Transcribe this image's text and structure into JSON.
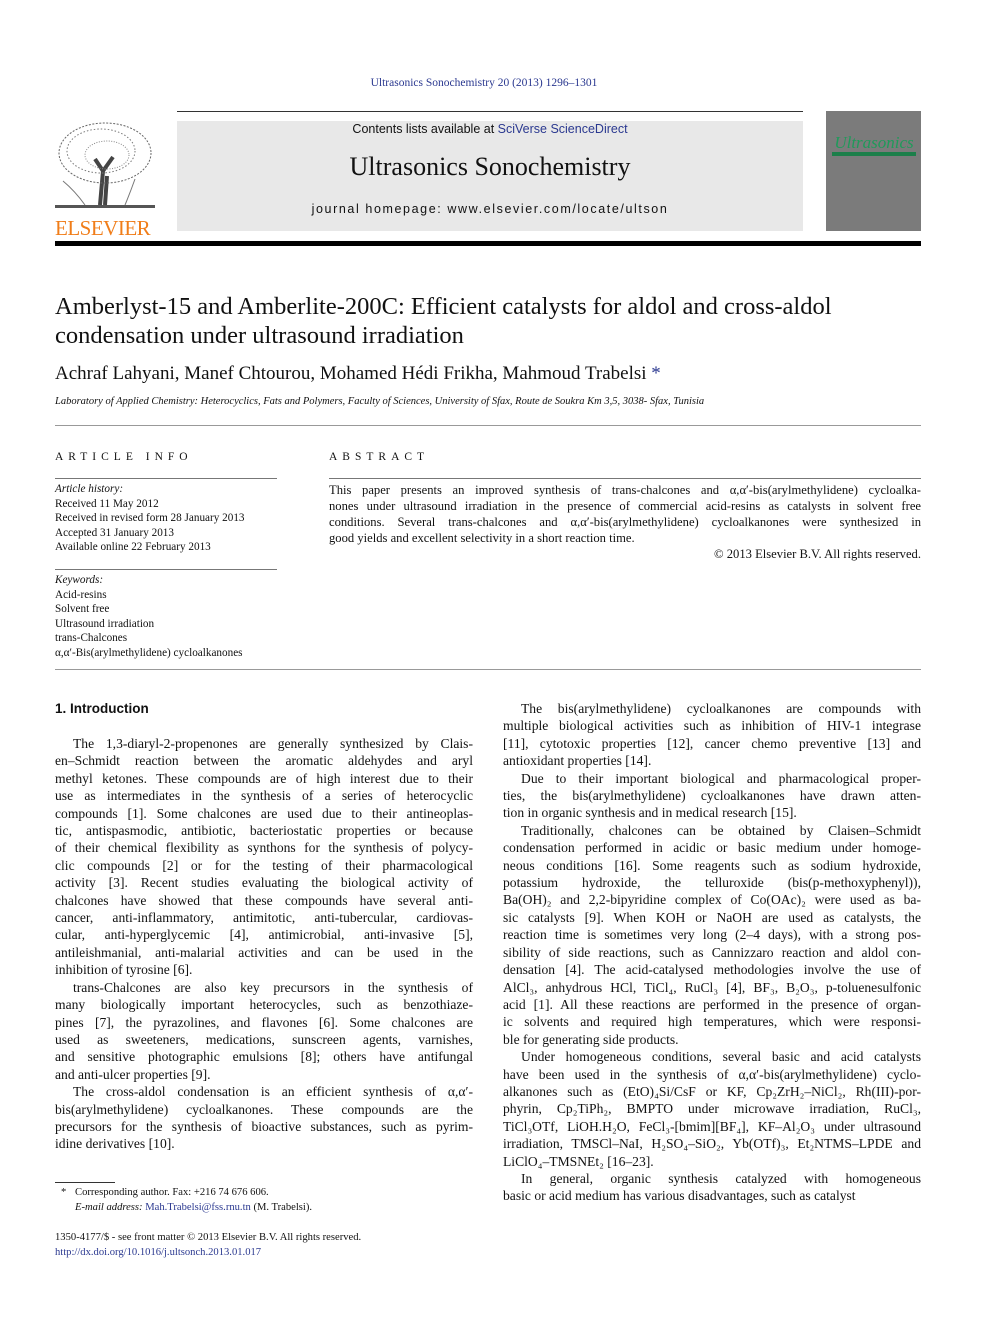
{
  "header": {
    "citation": "Ultrasonics Sonochemistry 20 (2013) 1296–1301",
    "contents_prefix": "Contents lists available at ",
    "contents_link": "SciVerse ScienceDirect",
    "journal_title": "Ultrasonics Sonochemistry",
    "homepage": "journal homepage: www.elsevier.com/locate/ultson",
    "publisher_logo": "ELSEVIER",
    "cover_title": "Ultrasonics",
    "colors": {
      "publisher_orange": "#f07d19",
      "link_blue": "#2b3990",
      "cover_green": "#1f9a5a"
    }
  },
  "article": {
    "title_line1": "Amberlyst-15 and Amberlite-200C: Efficient catalysts for aldol and cross-aldol",
    "title_line2": "condensation under ultrasound irradiation",
    "authors": "Achraf Lahyani, Manef Chtourou, Mohamed Hédi Frikha, Mahmoud Trabelsi",
    "author_mark": "*",
    "affiliation": "Laboratory of Applied Chemistry: Heterocyclics, Fats and Polymers, Faculty of Sciences, University of Sfax, Route de Soukra Km 3,5, 3038- Sfax, Tunisia"
  },
  "article_info": {
    "heading": "ARTICLE INFO",
    "history_label": "Article history:",
    "history": [
      "Received 11 May 2012",
      "Received in revised form 28 January 2013",
      "Accepted 31 January 2013",
      "Available online 22 February 2013"
    ],
    "keywords_label": "Keywords:",
    "keywords": [
      "Acid-resins",
      "Solvent free",
      "Ultrasound irradiation",
      "trans-Chalcones",
      "α,α′-Bis(arylmethylidene) cycloalkanones"
    ]
  },
  "abstract": {
    "heading": "ABSTRACT",
    "lines": [
      "This paper presents an improved synthesis of trans-chalcones and α,α′-bis(arylmethylidene) cycloalka-",
      "nones under ultrasound irradiation in the presence of commercial acid-resins as catalysts in solvent free",
      "conditions. Several trans-chalcones and α,α′-bis(arylmethylidene) cycloalkanones were synthesized in",
      "good yields and excellent selectivity in a short reaction time."
    ],
    "copyright": "© 2013 Elsevier B.V. All rights reserved."
  },
  "body": {
    "section_heading": "1. Introduction",
    "left_paragraphs": [
      [
        "The 1,3-diaryl-2-propenones are generally synthesized by Clais-",
        "en–Schmidt reaction between the aromatic aldehydes and aryl",
        "methyl ketones. These compounds are of high interest due to their",
        "use as intermediates in the synthesis of a series of heterocyclic",
        "compounds [1]. Some chalcones are used due to their antineoplas-",
        "tic, antispasmodic, antibiotic, bacteriostatic properties or because",
        "of their chemical flexibility as synthons for the synthesis of polycy-",
        "clic compounds [2] or for the testing of their pharmacological",
        "activity [3]. Recent studies evaluating the biological activity of",
        "chalcones have showed that these compounds have several anti-",
        "cancer, anti-inflammatory, antimitotic, anti-tubercular, cardiovas-",
        "cular, anti-hyperglycemic [4], antimicrobial, anti-invasive [5],",
        "antileishmanial, anti-malarial activities and can be used in the",
        "inhibition of tyrosine [6]."
      ],
      [
        "trans-Chalcones are also key precursors in the synthesis of",
        "many biologically important heterocycles, such as benzothiaze-",
        "pines [7], the pyrazolines, and flavones [6]. Some chalcones are",
        "used as sweeteners, medications, sunscreen agents, varnishes,",
        "and sensitive photographic emulsions [8]; others have antifungal",
        "and anti-ulcer properties [9]."
      ],
      [
        "The cross-aldol condensation is an efficient synthesis of α,α′-",
        "bis(arylmethylidene) cycloalkanones. These compounds are the",
        "precursors for the synthesis of bioactive substances, such as pyrim-",
        "idine derivatives [10]."
      ]
    ],
    "right_paragraphs": [
      [
        "The bis(arylmethylidene) cycloalkanones are compounds with",
        "multiple biological activities such as inhibition of HIV-1 integrase",
        "[11], cytotoxic properties [12], cancer chemo preventive [13] and",
        "antioxidant properties [14]."
      ],
      [
        "Due to their important biological and pharmacological proper-",
        "ties, the bis(arylmethylidene) cycloalkanones have drawn atten-",
        "tion in organic synthesis and in medical research [15]."
      ],
      [
        "Traditionally, chalcones can be obtained by Claisen–Schmidt",
        "condensation performed in acidic or basic medium under homoge-",
        "neous conditions [16]. Some reagents such as sodium hydroxide,",
        "potassium hydroxide, the telluroxide (bis(p-methoxyphenyl)),",
        "Ba(OH)₂ and 2,2-bipyridine complex of Co(OAc)₂ were used as ba-",
        "sic catalysts [9]. When KOH or NaOH are used as catalysts, the",
        "reaction time is sometimes very long (2–4 days), with a strong pos-",
        "sibility of side reactions, such as Cannizzaro reaction and aldol con-",
        "densation [4]. The acid-catalysed methodologies involve the use of",
        "AlCl₃, anhydrous HCl, TiCl₄, RuCl₃ [4], BF₃, B₂O₃, p-toluenesulfonic",
        "acid [1]. All these reactions are performed in the presence of organ-",
        "ic solvents and required high temperatures, which were responsi-",
        "ble for generating side products."
      ],
      [
        "Under homogeneous conditions, several basic and acid catalysts",
        "have been used in the synthesis of α,α′-bis(arylmethylidene) cyclo-",
        "alkanones such as (EtO)₄Si/CsF or KF, Cp₂ZrH₂–NiCl₂, Rh(III)-por-",
        "phyrin, Cp₂TiPh₂, BMPTO under microwave irradiation, RuCl₃,",
        "TiCl₃OTf, LiOH.H₂O, FeCl₃-[bmim][BF₄], KF–Al₂O₃ under ultrasound",
        "irradiation, TMSCl–NaI, H₂SO₄–SiO₂, Yb(OTf)₃, Et₂NTMS–LPDE and",
        "LiClO₄–TMSNEt₂ [16–23]."
      ],
      [
        "In general, organic synthesis catalyzed with homogeneous",
        "basic or acid medium has various disadvantages, such as catalyst"
      ]
    ]
  },
  "footnote": {
    "mark": "*",
    "corresponding": "Corresponding author. Fax: +216 74 676 606.",
    "email_label": "E-mail address:",
    "email": "Mah.Trabelsi@fss.rnu.tn",
    "email_suffix": "(M. Trabelsi)."
  },
  "footer": {
    "issn": "1350-4177/$ - see front matter © 2013 Elsevier B.V. All rights reserved.",
    "doi": "http://dx.doi.org/10.1016/j.ultsonch.2013.01.017"
  }
}
